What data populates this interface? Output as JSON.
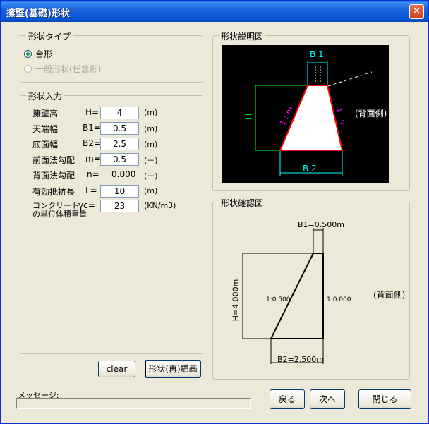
{
  "window": {
    "title": "擁壁(基礎)形状",
    "close_label": "✕"
  },
  "shape_type": {
    "legend": "形状タイプ",
    "options": [
      {
        "label": "台形",
        "checked": true,
        "disabled": false
      },
      {
        "label": "一般形状(任意形)",
        "checked": false,
        "disabled": true
      }
    ]
  },
  "shape_input": {
    "legend": "形状入力",
    "fields": [
      {
        "label": "擁壁高",
        "var": "H=",
        "value": "4",
        "unit": "(m)"
      },
      {
        "label": "天端幅",
        "var": "B1=",
        "value": "0.5",
        "unit": "(m)"
      },
      {
        "label": "底面幅",
        "var": "B2=",
        "value": "2.5",
        "unit": "(m)"
      },
      {
        "label": "前面法勾配",
        "var": "m=",
        "value": "0.5",
        "unit": "(－)"
      },
      {
        "label": "背面法勾配",
        "var": "n=",
        "value": "0.000",
        "unit": "(－)"
      },
      {
        "label": "有効抵抗長",
        "var": "L=",
        "value": "10",
        "unit": "(m)"
      },
      {
        "label": "コンクリート\nの単位体積重量",
        "label1": "コンクリート",
        "label2": "の単位体積重量",
        "var": "γc=",
        "value": "23",
        "unit": "(KN/m3)"
      }
    ]
  },
  "buttons": {
    "clear": "clear",
    "redraw": "形状(再)描画",
    "back": "戻る",
    "next": "次へ",
    "close": "閉じる"
  },
  "explain_diagram": {
    "legend": "形状説明図",
    "b1": "B 1",
    "b2": "B 2",
    "h": "H",
    "m": "1 : m",
    "n": "1 : n",
    "back_side": "(背面側)"
  },
  "confirm_diagram": {
    "legend": "形状確認図",
    "b1": "B1=0.500m",
    "b2": "B2=2.500m",
    "h": "H=4.000m",
    "front_slope": "1:0.500",
    "back_slope": "1:0.000",
    "back_side": "(背面側)"
  },
  "message": {
    "label": "メッセージ:",
    "text": ""
  },
  "colors": {
    "title_bar": "#0553d0",
    "diagram_bg": "#000000",
    "trapezoid_fill": "#ffffff",
    "trapezoid_edge": "#ff0000",
    "dimension": "#00ffff",
    "height_dim": "#00ff00",
    "slope_label": "#ff00ff"
  }
}
